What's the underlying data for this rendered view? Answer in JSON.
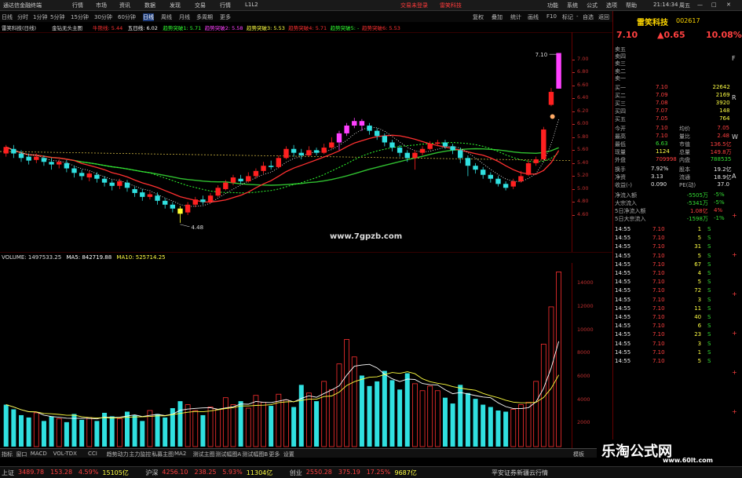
{
  "window": {
    "title": "通达信金融终端",
    "menus": [
      "行情",
      "市场",
      "资讯",
      "数据",
      "发现",
      "交易",
      "行情",
      "L1L2"
    ],
    "right_menus": [
      "交易未登录",
      "雷笑科技",
      "功能",
      "系统",
      "公式",
      "选项",
      "帮助"
    ],
    "clock": "21:14:34",
    "controls": [
      "周五",
      "—",
      "□",
      "✕"
    ]
  },
  "periods": [
    "日线",
    "分时",
    "1分钟",
    "5分钟",
    "15分钟",
    "30分钟",
    "60分钟",
    "日线",
    "周线",
    "月线",
    "多周期",
    "更多"
  ],
  "toolbar_right": [
    "复权",
    "叠加",
    "统计",
    "画线",
    "F10",
    "标记",
    "-",
    "自选",
    "返回"
  ],
  "indicator": {
    "stock": "雷笑科技(日线)",
    "formula": "金钻无头主图",
    "items": [
      {
        "t": "牛熊线: 5.44",
        "c": "#ff3030"
      },
      {
        "t": "五日线: 6.02",
        "c": "#ffffff"
      },
      {
        "t": "趋势突破1: 5.71",
        "c": "#30ff30"
      },
      {
        "t": "趋势突破2: 5.58",
        "c": "#ff40ff"
      },
      {
        "t": "趋势突破3: 5.53",
        "c": "#ffff40"
      },
      {
        "t": "趋势突破4: 5.71",
        "c": "#ff3030"
      },
      {
        "t": "趋势突破5: -",
        "c": "#30ff30"
      },
      {
        "t": "趋势突破6: 5.53",
        "c": "#ff3030"
      }
    ]
  },
  "chart_data": [
    {
      "type": "candlestick",
      "title": "雷笑科技(日线) 金钻无头主图",
      "ylim": [
        4.2,
        7.3
      ],
      "yticks": [
        "7.00",
        "6.80",
        "6.60",
        "6.40",
        "6.20",
        "6.00",
        "5.80",
        "5.60",
        "5.40",
        "5.20",
        "5.00",
        "4.80",
        "4.60"
      ],
      "high_label": "7.10",
      "low_label": "4.48",
      "candles": [
        [
          5.55,
          5.65,
          5.5,
          5.68
        ],
        [
          5.62,
          5.55,
          5.48,
          5.68
        ],
        [
          5.55,
          5.48,
          5.42,
          5.6
        ],
        [
          5.5,
          5.44,
          5.38,
          5.55
        ],
        [
          5.45,
          5.5,
          5.4,
          5.55
        ],
        [
          5.48,
          5.42,
          5.36,
          5.52
        ],
        [
          5.42,
          5.38,
          5.3,
          5.48
        ],
        [
          5.38,
          5.42,
          5.32,
          5.46
        ],
        [
          5.4,
          5.32,
          5.26,
          5.45
        ],
        [
          5.32,
          5.25,
          5.18,
          5.36
        ],
        [
          5.25,
          5.2,
          5.14,
          5.3
        ],
        [
          5.18,
          5.24,
          5.12,
          5.28
        ],
        [
          5.22,
          5.16,
          5.1,
          5.26
        ],
        [
          5.16,
          5.1,
          5.04,
          5.2
        ],
        [
          5.1,
          5.05,
          4.98,
          5.14
        ],
        [
          5.05,
          5.12,
          5.0,
          5.16
        ],
        [
          5.1,
          5.02,
          4.96,
          5.14
        ],
        [
          5.0,
          4.94,
          4.88,
          5.04
        ],
        [
          4.95,
          4.88,
          4.82,
          5.0
        ],
        [
          4.88,
          4.92,
          4.84,
          4.96
        ],
        [
          4.9,
          4.82,
          4.76,
          4.95
        ],
        [
          4.82,
          4.76,
          4.7,
          4.86
        ],
        [
          4.76,
          4.7,
          4.64,
          4.8
        ],
        [
          4.7,
          4.62,
          4.48,
          4.74
        ],
        [
          4.64,
          4.76,
          4.6,
          4.8
        ],
        [
          4.76,
          4.84,
          4.72,
          4.88
        ],
        [
          4.84,
          4.8,
          4.76,
          4.9
        ],
        [
          4.8,
          4.9,
          4.78,
          4.94
        ],
        [
          4.9,
          5.02,
          4.88,
          5.06
        ],
        [
          5.0,
          5.1,
          4.98,
          5.14
        ],
        [
          5.1,
          5.18,
          5.06,
          5.22
        ],
        [
          5.16,
          5.12,
          5.08,
          5.22
        ],
        [
          5.12,
          5.2,
          5.1,
          5.26
        ],
        [
          5.2,
          5.28,
          5.16,
          5.32
        ],
        [
          5.28,
          5.36,
          5.24,
          5.42
        ],
        [
          5.36,
          5.34,
          5.3,
          5.44
        ],
        [
          5.34,
          5.48,
          5.32,
          5.52
        ],
        [
          5.48,
          5.62,
          5.46,
          5.66
        ],
        [
          5.62,
          5.56,
          5.5,
          5.68
        ],
        [
          5.56,
          5.52,
          5.46,
          5.62
        ],
        [
          5.52,
          5.6,
          5.5,
          5.66
        ],
        [
          5.6,
          5.56,
          5.52,
          5.64
        ],
        [
          5.56,
          5.64,
          5.54,
          5.7
        ],
        [
          5.64,
          5.72,
          5.62,
          5.8
        ],
        [
          5.72,
          5.86,
          5.6,
          5.9
        ],
        [
          5.86,
          5.98,
          5.82,
          6.02
        ],
        [
          5.98,
          6.05,
          5.94,
          6.1
        ],
        [
          6.05,
          5.98,
          5.9,
          6.08
        ],
        [
          5.98,
          5.9,
          5.84,
          6.02
        ],
        [
          5.9,
          5.82,
          5.76,
          5.94
        ],
        [
          5.82,
          5.72,
          5.66,
          5.86
        ],
        [
          5.72,
          5.64,
          5.58,
          5.76
        ],
        [
          5.64,
          5.56,
          5.5,
          5.68
        ],
        [
          5.56,
          5.48,
          5.42,
          5.6
        ],
        [
          5.48,
          5.56,
          5.3,
          5.6
        ],
        [
          5.56,
          5.62,
          5.52,
          5.66
        ],
        [
          5.62,
          5.7,
          5.6,
          5.74
        ],
        [
          5.7,
          5.72,
          5.66,
          5.76
        ],
        [
          5.72,
          5.66,
          5.62,
          5.76
        ],
        [
          5.66,
          5.6,
          5.54,
          5.7
        ],
        [
          5.6,
          5.48,
          5.4,
          5.64
        ],
        [
          5.48,
          5.36,
          5.2,
          5.52
        ],
        [
          5.36,
          5.3,
          5.24,
          5.4
        ],
        [
          5.3,
          5.22,
          5.16,
          5.34
        ],
        [
          5.22,
          5.16,
          5.1,
          5.26
        ],
        [
          5.16,
          5.08,
          5.04,
          5.2
        ],
        [
          5.08,
          5.02,
          4.98,
          5.12
        ],
        [
          5.04,
          5.12,
          5.0,
          5.16
        ],
        [
          5.12,
          5.2,
          5.1,
          5.28
        ],
        [
          5.22,
          5.4,
          5.2,
          5.44
        ],
        [
          5.4,
          5.46,
          5.36,
          5.5
        ],
        [
          5.46,
          5.92,
          5.44,
          5.96
        ],
        [
          6.3,
          6.5,
          6.28,
          6.56
        ],
        [
          6.55,
          7.1,
          6.55,
          7.1
        ]
      ],
      "dashed_levels": {
        "upper": 5.58,
        "yellow": 5.44
      }
    },
    {
      "type": "bar",
      "title": "VOLUME",
      "ylim": [
        0,
        15500
      ],
      "yticks": [
        "14000",
        "12000",
        "10000",
        "8000",
        "6000",
        "4000",
        "2000"
      ],
      "volume": [
        3600,
        3200,
        2700,
        2500,
        2900,
        2200,
        2600,
        2400,
        2100,
        2800,
        2300,
        2500,
        2200,
        2900,
        2600,
        2400,
        3000,
        2700,
        2200,
        3100,
        2800,
        2500,
        3300,
        3900,
        3600,
        3100,
        2700,
        3400,
        3200,
        4200,
        3600,
        3900,
        3300,
        4400,
        3800,
        3500,
        4500,
        4000,
        3400,
        5300,
        4600,
        3900,
        5600,
        4900,
        7100,
        9200,
        7700,
        6100,
        5200,
        5600,
        6500,
        5700,
        4900,
        6300,
        5400,
        4800,
        5200,
        4800,
        4200,
        3700,
        5300,
        4600,
        4100,
        3600,
        3400,
        3100,
        3000,
        3200,
        3600,
        3800,
        5600,
        8800,
        12000,
        15000
      ],
      "vol_up": [
        0,
        0,
        0,
        0,
        1,
        0,
        0,
        1,
        0,
        0,
        0,
        1,
        0,
        0,
        0,
        1,
        0,
        0,
        0,
        1,
        0,
        0,
        0,
        0,
        1,
        1,
        0,
        1,
        1,
        1,
        1,
        0,
        1,
        1,
        1,
        0,
        1,
        1,
        0,
        0,
        1,
        0,
        1,
        1,
        1,
        1,
        1,
        0,
        0,
        0,
        0,
        0,
        0,
        0,
        1,
        1,
        1,
        1,
        0,
        0,
        0,
        0,
        0,
        0,
        0,
        0,
        0,
        1,
        1,
        1,
        1,
        1,
        1,
        1
      ]
    }
  ],
  "vol_header": {
    "name": "VOLUME: 1497533.25",
    "ma5": "MA5: 842719.88",
    "ma10": "MA10: 525714.25"
  },
  "watermark_center": "www.7gpzb.com",
  "bottom_tabs": [
    "指标",
    "窗口",
    "MACD",
    "VOL-TDX",
    "CCI",
    "趋势动力",
    "主力监控",
    "私募主图",
    "MA2",
    "测试主图",
    "测试幅图A",
    "测试幅图B",
    "更多",
    "设置",
    "模板"
  ],
  "status": [
    {
      "t": "上证",
      "c": "#ccc"
    },
    {
      "t": "3489.78",
      "c": "#ff4040"
    },
    {
      "t": "153.28",
      "c": "#ff4040"
    },
    {
      "t": "4.59%",
      "c": "#ff4040"
    },
    {
      "t": "15105亿",
      "c": "#ffff44"
    },
    {
      "t": "沪深",
      "c": "#ccc"
    },
    {
      "t": "4256.10",
      "c": "#ff4040"
    },
    {
      "t": "238.25",
      "c": "#ff4040"
    },
    {
      "t": "5.93%",
      "c": "#ff4040"
    },
    {
      "t": "11304亿",
      "c": "#ffff44"
    },
    {
      "t": "创业",
      "c": "#ccc"
    },
    {
      "t": "2550.28",
      "c": "#ff4040"
    },
    {
      "t": "375.19",
      "c": "#ff4040"
    },
    {
      "t": "17.25%",
      "c": "#ff4040"
    },
    {
      "t": "9687亿",
      "c": "#ffff44"
    },
    {
      "t": "平安证券新疆云行情",
      "c": "#ccc"
    }
  ],
  "quote": {
    "name": "雷笑科技",
    "code": "002617",
    "price": "7.10",
    "chg": "▲0.65",
    "pct": "10.08%",
    "asks": [
      {
        "l": "卖五",
        "p": "",
        "v": ""
      },
      {
        "l": "卖四",
        "p": "",
        "v": ""
      },
      {
        "l": "卖三",
        "p": "",
        "v": ""
      },
      {
        "l": "卖二",
        "p": "",
        "v": ""
      },
      {
        "l": "卖一",
        "p": "",
        "v": ""
      }
    ],
    "bids": [
      {
        "l": "买一",
        "p": "7.10",
        "v": "22642"
      },
      {
        "l": "买二",
        "p": "7.09",
        "v": "2169"
      },
      {
        "l": "买三",
        "p": "7.08",
        "v": "3920"
      },
      {
        "l": "买四",
        "p": "7.07",
        "v": "148"
      },
      {
        "l": "买五",
        "p": "7.05",
        "v": "764"
      }
    ],
    "stats": [
      [
        "今开",
        "7.10",
        "均价",
        "7.05"
      ],
      [
        "最高",
        "7.10",
        "量比",
        "2.48"
      ],
      [
        "最低",
        "6.63",
        "市值",
        "136.5亿"
      ],
      [
        "现量",
        "1124",
        "总量",
        "149.8万"
      ],
      [
        "外盘",
        "709998",
        "内盘",
        "788535"
      ]
    ],
    "stats2": [
      [
        "换手",
        "7.92%",
        "股本",
        "19.2亿"
      ],
      [
        "净资",
        "3.13",
        "流通",
        "18.9亿"
      ],
      [
        "收益(-)",
        "0.090",
        "PE(动)",
        "37.0"
      ]
    ],
    "flow": [
      [
        "净流入额",
        "-5505万",
        "-5%"
      ],
      [
        "大宗流入",
        "-5341万",
        "-5%"
      ],
      [
        "5日净流入额",
        "1.08亿",
        "4%"
      ],
      [
        "5日大宗流入",
        "-1598万",
        "-1%"
      ]
    ],
    "ticks": [
      [
        "14:55",
        "7.10",
        "1",
        "S"
      ],
      [
        "14:55",
        "7.10",
        "5",
        "S"
      ],
      [
        "14:55",
        "7.10",
        "31",
        "S"
      ],
      [
        "14:55",
        "7.10",
        "5",
        "S"
      ],
      [
        "14:55",
        "7.10",
        "67",
        "S"
      ],
      [
        "14:55",
        "7.10",
        "4",
        "S"
      ],
      [
        "14:55",
        "7.10",
        "5",
        "S"
      ],
      [
        "14:55",
        "7.10",
        "72",
        "S"
      ],
      [
        "14:55",
        "7.10",
        "3",
        "S"
      ],
      [
        "14:55",
        "7.10",
        "11",
        "S"
      ],
      [
        "14:55",
        "7.10",
        "40",
        "S"
      ],
      [
        "14:55",
        "7.10",
        "6",
        "S"
      ],
      [
        "14:55",
        "7.10",
        "23",
        "S"
      ],
      [
        "14:55",
        "7.10",
        "3",
        "S"
      ],
      [
        "14:55",
        "7.10",
        "1",
        "S"
      ],
      [
        "14:55",
        "7.10",
        "5",
        "S"
      ]
    ]
  },
  "side_tabs": [
    "F",
    "R",
    "W",
    "A",
    "+",
    "+",
    "+",
    "+",
    "+",
    "+"
  ],
  "watermark": {
    "big": "乐淘公式网",
    "url": "www.60lt.com"
  }
}
